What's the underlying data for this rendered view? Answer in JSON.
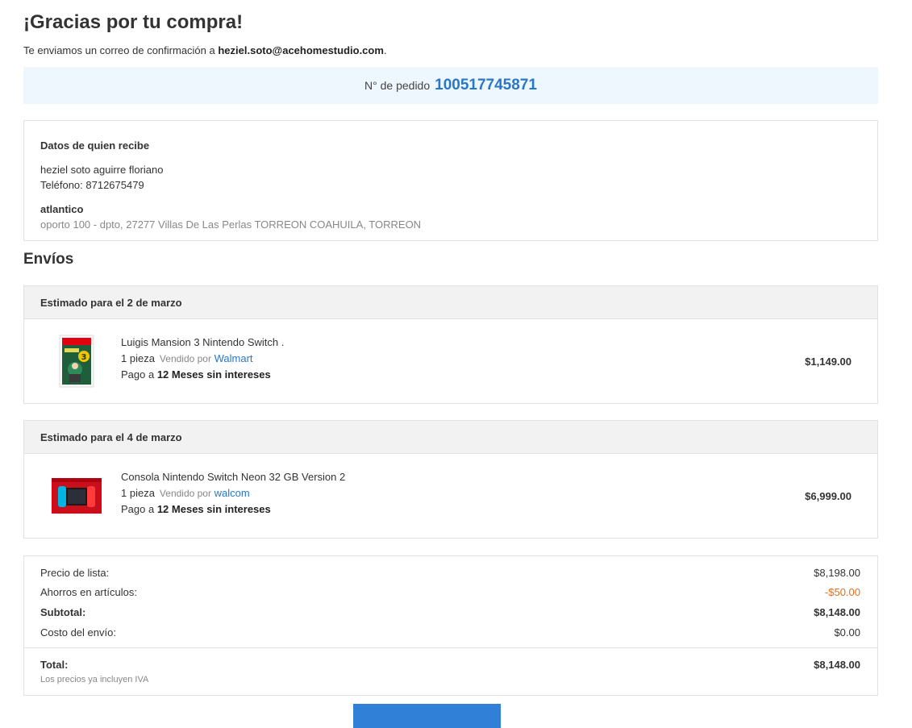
{
  "header": {
    "title": "¡Gracias por tu compra!",
    "confirm_text": "Te enviamos un correo de confirmación a ",
    "email": "heziel.soto@acehomestudio.com",
    "confirm_end": "."
  },
  "order": {
    "label": "N° de pedido",
    "number": "100517745871"
  },
  "recipient": {
    "label": "Datos de quien recibe",
    "name": "heziel soto aguirre floriano",
    "phone": "Teléfono: 8712675479",
    "store": "atlantico",
    "address": "oporto 100 - dpto, 27277 Villas De Las Perlas TORREON COAHUILA, TORREON"
  },
  "shipments_title": "Envíos",
  "shipments": [
    {
      "estimate": "Estimado para el 2 de marzo",
      "title": "Luigis Mansion 3 Nintendo Switch .",
      "qty": "1 pieza",
      "sold_by": "Vendido por",
      "seller": "Walmart",
      "pay_prefix": "Pago a ",
      "pay_plan": "12 Meses sin intereses",
      "price": "$1,149.00",
      "thumb_icon": "game-box-icon"
    },
    {
      "estimate": "Estimado para el 4 de marzo",
      "title": "Consola Nintendo Switch Neon 32 GB Version 2",
      "qty": "1 pieza",
      "sold_by": "Vendido por",
      "seller": "walcom",
      "pay_prefix": "Pago a ",
      "pay_plan": "12 Meses sin intereses",
      "price": "$6,999.00",
      "thumb_icon": "console-box-icon"
    }
  ],
  "summary": {
    "list_price_label": "Precio de lista:",
    "list_price": "$8,198.00",
    "savings_label": "Ahorros en artículos:",
    "savings": "-$50.00",
    "subtotal_label": "Subtotal:",
    "subtotal": "$8,148.00",
    "shipping_label": "Costo del envío:",
    "shipping": "$0.00",
    "total_label": "Total:",
    "total": "$8,148.00",
    "iva_note": "Los precios ya incluyen IVA"
  },
  "colors": {
    "accent": "#2878c8",
    "order_bar_bg": "#eef6fe",
    "savings": "#e07020",
    "button": "#2f80d6"
  }
}
